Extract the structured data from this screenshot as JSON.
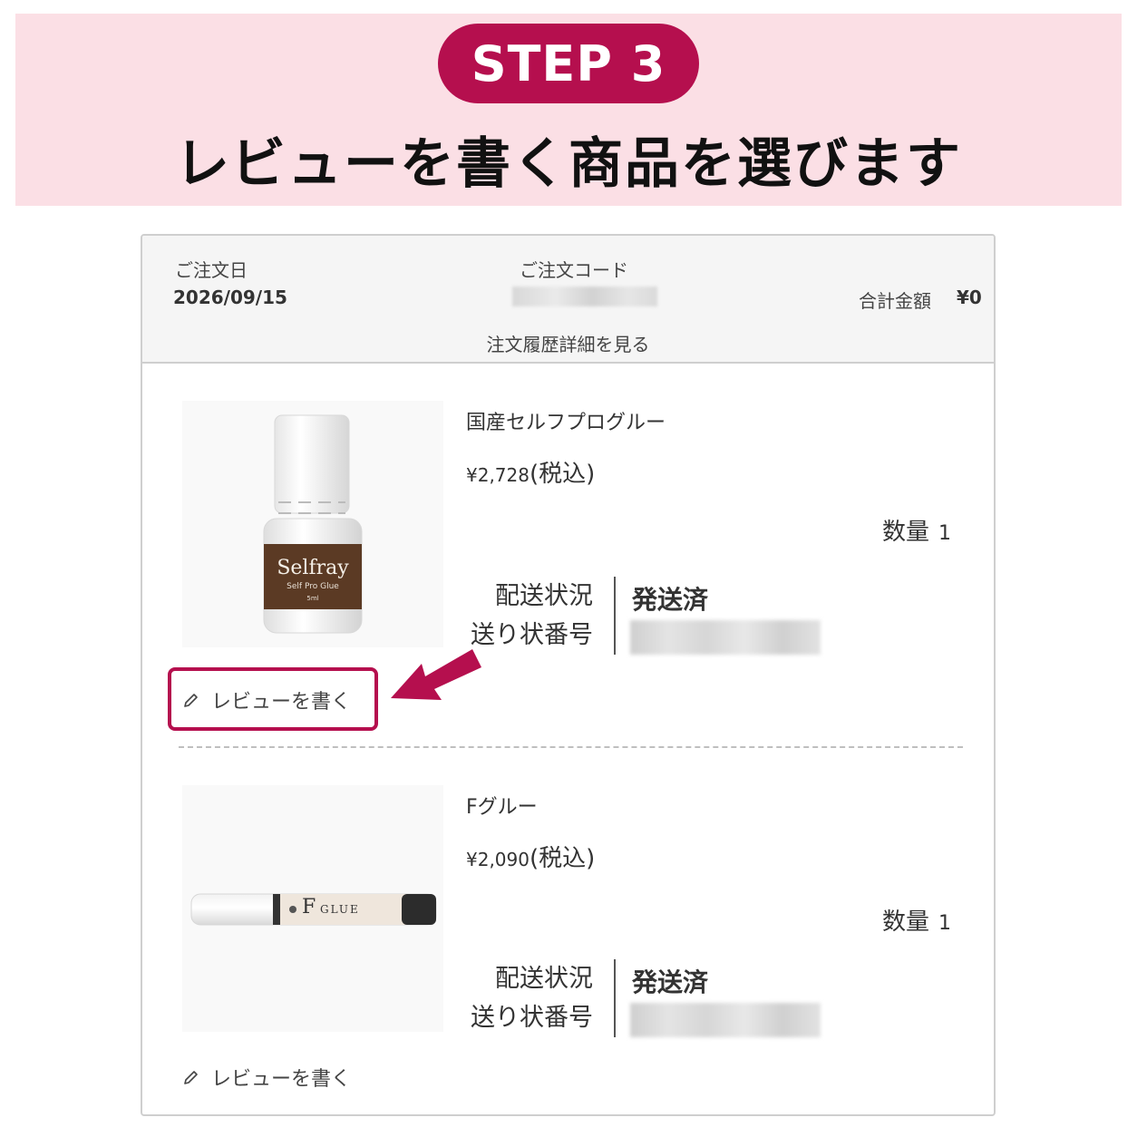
{
  "banner": {
    "step": "STEP 3",
    "title": "レビューを書く商品を選びます"
  },
  "colors": {
    "accent": "#b50f4e",
    "banner_bg": "#fbdfe5"
  },
  "order": {
    "date_label": "ご注文日",
    "date_value": "2026/09/15",
    "code_label": "ご注文コード",
    "total_label": "合計金額",
    "total_value": "¥0",
    "detail_link": "注文履歴詳細を見る"
  },
  "products": [
    {
      "name": "国産セルフプログルー",
      "price": "¥2,728",
      "tax": "(税込)",
      "qty_label": "数量",
      "qty": "1",
      "ship_status_label": "配送状況",
      "tracking_label": "送り状番号",
      "ship_status": "発送済",
      "image_brand": "Selfray",
      "image_sub": "Self Pro Glue",
      "image_vol": "5ml",
      "review_label": "レビューを書く",
      "icon": "pencil-icon"
    },
    {
      "name": "Fグルー",
      "price": "¥2,090",
      "tax": "(税込)",
      "qty_label": "数量",
      "qty": "1",
      "ship_status_label": "配送状況",
      "tracking_label": "送り状番号",
      "ship_status": "発送済",
      "image_brand_f": "F",
      "image_brand_glue": "GLUE",
      "review_label": "レビューを書く",
      "icon": "pencil-icon"
    }
  ]
}
